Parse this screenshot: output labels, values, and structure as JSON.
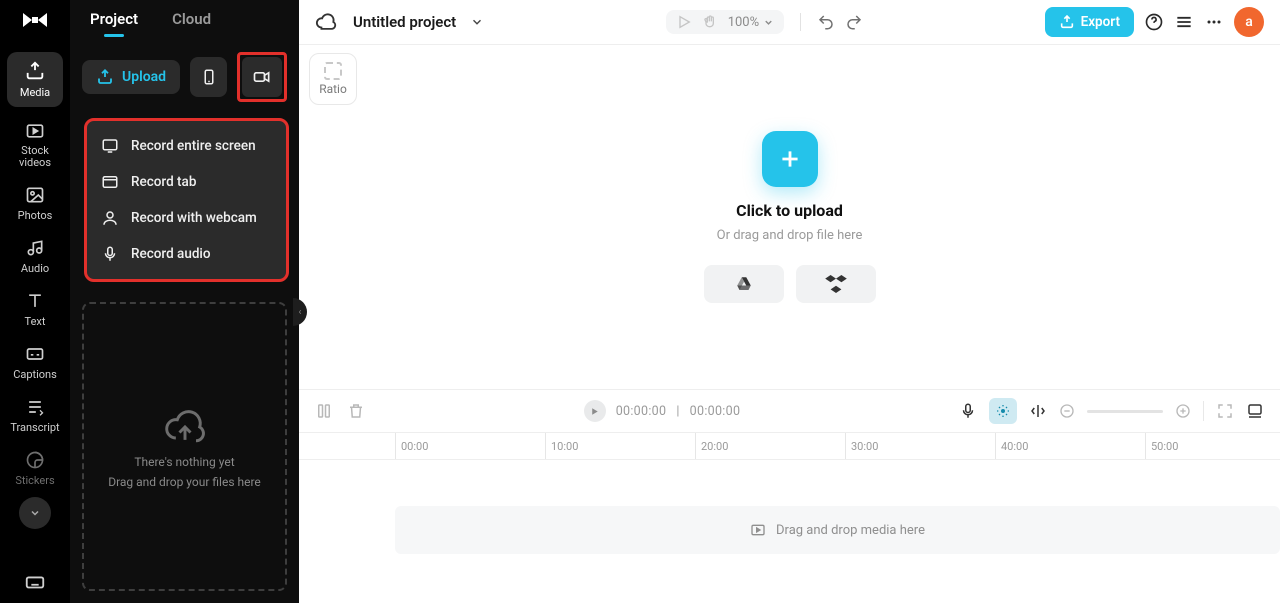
{
  "rail": {
    "items": [
      {
        "label": "Media"
      },
      {
        "label": "Stock videos"
      },
      {
        "label": "Photos"
      },
      {
        "label": "Audio"
      },
      {
        "label": "Text"
      },
      {
        "label": "Captions"
      },
      {
        "label": "Transcript"
      },
      {
        "label": "Stickers"
      }
    ]
  },
  "panel": {
    "tabs": {
      "project": "Project",
      "cloud": "Cloud"
    },
    "upload_label": "Upload",
    "record_menu": [
      {
        "label": "Record entire screen"
      },
      {
        "label": "Record tab"
      },
      {
        "label": "Record with webcam"
      },
      {
        "label": "Record audio"
      }
    ],
    "empty_title": "There's nothing yet",
    "empty_sub": "Drag and drop your files here"
  },
  "topbar": {
    "project_title": "Untitled project",
    "zoom": "100%",
    "export_label": "Export",
    "avatar_initial": "a"
  },
  "stage": {
    "ratio_label": "Ratio",
    "upload_title": "Click to upload",
    "upload_sub": "Or drag and drop file here"
  },
  "timeline": {
    "time_current": "00:00:00",
    "time_total": "00:00:00",
    "ticks": [
      "00:00",
      "10:00",
      "20:00",
      "30:00",
      "40:00",
      "50:00"
    ],
    "drop_hint": "Drag and drop media here"
  }
}
